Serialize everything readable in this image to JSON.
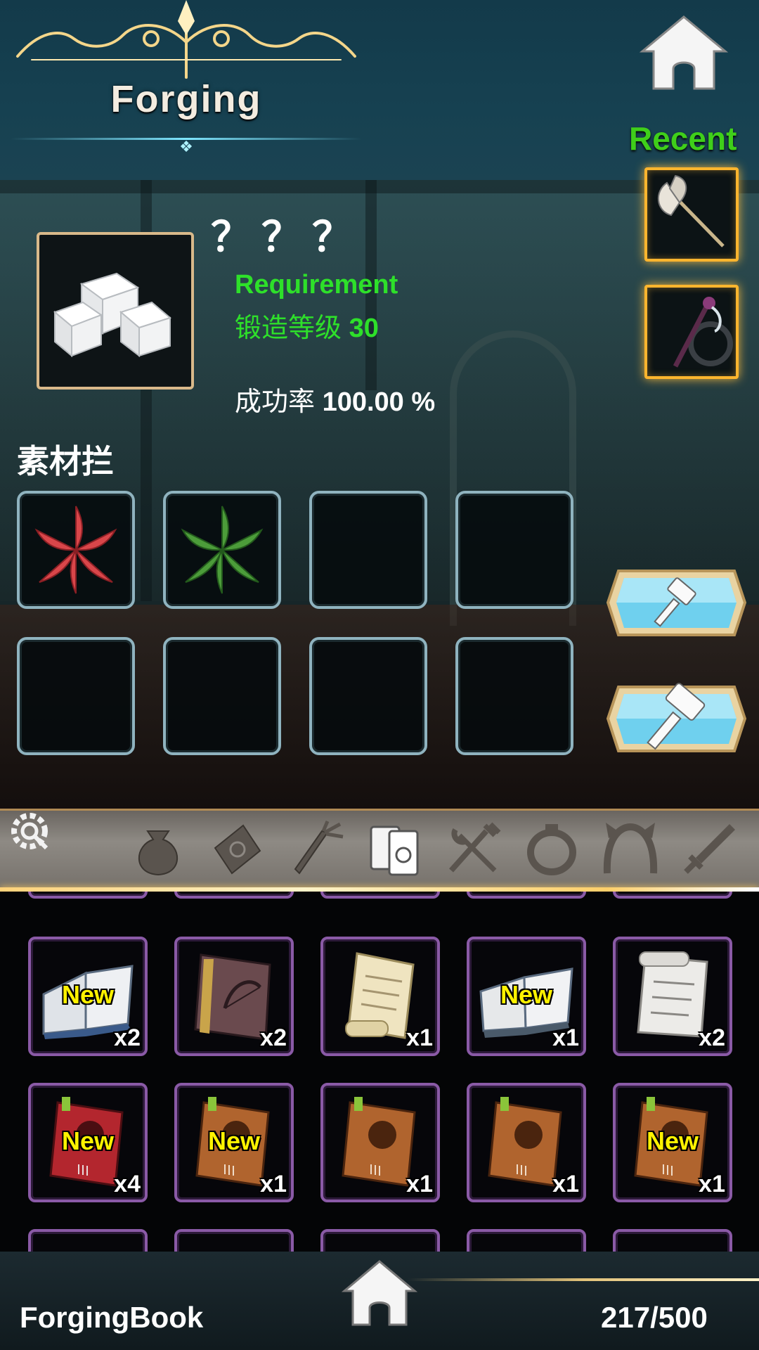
{
  "header": {
    "title": "Forging",
    "recent_label": "Recent",
    "recent_items": [
      {
        "icon": "halberd-icon"
      },
      {
        "icon": "dark-staff-icon"
      }
    ]
  },
  "selected_item": {
    "name": "？？？",
    "icon": "white-crystal-cubes-icon",
    "requirement_label": "Requirement",
    "requirement_text": "锻造等级",
    "requirement_level": "30",
    "success_label": "成功率",
    "success_value": "100.00 %"
  },
  "materials": {
    "title": "素材拦",
    "slots": [
      {
        "icon": "red-leaf-icon"
      },
      {
        "icon": "green-leaf-icon"
      },
      {
        "icon": ""
      },
      {
        "icon": ""
      },
      {
        "icon": ""
      },
      {
        "icon": ""
      },
      {
        "icon": ""
      },
      {
        "icon": ""
      }
    ]
  },
  "forge_buttons": [
    {
      "icon": "small-hammer-icon"
    },
    {
      "icon": "large-hammer-icon"
    }
  ],
  "categories": [
    {
      "icon": "pouch-icon"
    },
    {
      "icon": "envelope-icon"
    },
    {
      "icon": "carrot-icon"
    },
    {
      "icon": "book-icon",
      "active": true
    },
    {
      "icon": "utensils-icon"
    },
    {
      "icon": "ring-icon"
    },
    {
      "icon": "headband-icon"
    },
    {
      "icon": "sword-icon"
    }
  ],
  "inventory": [
    {
      "icon": "open-book-blue",
      "new": "New",
      "qty": "x2"
    },
    {
      "icon": "bow-tome",
      "new": "",
      "qty": "x2"
    },
    {
      "icon": "parchment-scroll",
      "new": "",
      "qty": "x1"
    },
    {
      "icon": "open-book-grey",
      "new": "New",
      "qty": "x1"
    },
    {
      "icon": "white-scroll",
      "new": "",
      "qty": "x2"
    },
    {
      "icon": "red-recipe-book",
      "new": "New",
      "qty": "x4"
    },
    {
      "icon": "brown-recipe-book",
      "new": "New",
      "qty": "x1"
    },
    {
      "icon": "brown-recipe-book",
      "new": "",
      "qty": "x1"
    },
    {
      "icon": "brown-recipe-book",
      "new": "",
      "qty": "x1"
    },
    {
      "icon": "brown-recipe-book",
      "new": "New",
      "qty": "x1"
    }
  ],
  "footer": {
    "label": "ForgingBook",
    "capacity": "217/500"
  },
  "colors": {
    "requirement": "#2ee02a",
    "recent": "#3fcf1a",
    "new_badge": "#fff200",
    "slot_border": "#8a5aa6",
    "recent_frame": "#ffb52e"
  }
}
